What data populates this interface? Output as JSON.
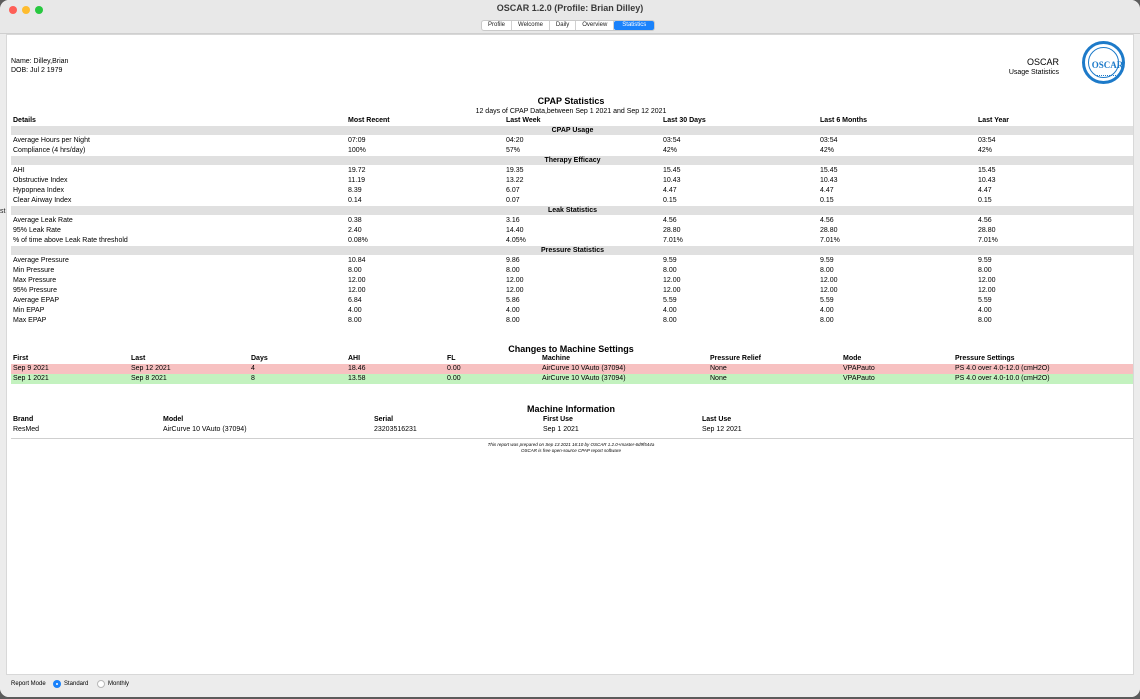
{
  "window": {
    "title": "OSCAR 1.2.0 (Profile: Brian Dilley)"
  },
  "tabs": [
    {
      "label": "Profile",
      "active": false
    },
    {
      "label": "Welcome",
      "active": false
    },
    {
      "label": "Daily",
      "active": false
    },
    {
      "label": "Overview",
      "active": false
    },
    {
      "label": "Statistics",
      "active": true
    }
  ],
  "header": {
    "name": "Name: Dilley,Brian",
    "dob": "DOB: Jul 2 1979",
    "app": "OSCAR",
    "subtitle": "Usage Statistics",
    "logo_text": "OSCAR"
  },
  "cpap": {
    "title": "CPAP Statistics",
    "subtitle": "12 days of CPAP Data,between Sep 1 2021 and Sep 12 2021",
    "columns": [
      "Details",
      "Most Recent",
      "Last Week",
      "Last 30 Days",
      "Last 6 Months",
      "Last Year"
    ],
    "sections": [
      {
        "title": "CPAP Usage",
        "rows": [
          [
            "Average Hours per Night",
            "07:09",
            "04:20",
            "03:54",
            "03:54",
            "03:54"
          ],
          [
            "Compliance (4 hrs/day)",
            "100%",
            "57%",
            "42%",
            "42%",
            "42%"
          ]
        ]
      },
      {
        "title": "Therapy Efficacy",
        "rows": [
          [
            "AHI",
            "19.72",
            "19.35",
            "15.45",
            "15.45",
            "15.45"
          ],
          [
            "Obstructive Index",
            "11.19",
            "13.22",
            "10.43",
            "10.43",
            "10.43"
          ],
          [
            "Hypopnea Index",
            "8.39",
            "6.07",
            "4.47",
            "4.47",
            "4.47"
          ],
          [
            "Clear Airway Index",
            "0.14",
            "0.07",
            "0.15",
            "0.15",
            "0.15"
          ]
        ]
      },
      {
        "title": "Leak Statistics",
        "rows": [
          [
            "Average Leak Rate",
            "0.38",
            "3.16",
            "4.56",
            "4.56",
            "4.56"
          ],
          [
            "95% Leak Rate",
            "2.40",
            "14.40",
            "28.80",
            "28.80",
            "28.80"
          ],
          [
            "% of time above Leak Rate threshold",
            "0.08%",
            "4.05%",
            "7.01%",
            "7.01%",
            "7.01%"
          ]
        ]
      },
      {
        "title": "Pressure Statistics",
        "rows": [
          [
            "Average Pressure",
            "10.84",
            "9.86",
            "9.59",
            "9.59",
            "9.59"
          ],
          [
            "Min Pressure",
            "8.00",
            "8.00",
            "8.00",
            "8.00",
            "8.00"
          ],
          [
            "Max Pressure",
            "12.00",
            "12.00",
            "12.00",
            "12.00",
            "12.00"
          ],
          [
            "95% Pressure",
            "12.00",
            "12.00",
            "12.00",
            "12.00",
            "12.00"
          ],
          [
            "Average EPAP",
            "6.84",
            "5.86",
            "5.59",
            "5.59",
            "5.59"
          ],
          [
            "Min EPAP",
            "4.00",
            "4.00",
            "4.00",
            "4.00",
            "4.00"
          ],
          [
            "Max EPAP",
            "8.00",
            "8.00",
            "8.00",
            "8.00",
            "8.00"
          ]
        ]
      }
    ]
  },
  "changes": {
    "title": "Changes to Machine Settings",
    "columns": [
      "First",
      "Last",
      "Days",
      "AHI",
      "FL",
      "Machine",
      "Pressure Relief",
      "Mode",
      "Pressure Settings"
    ],
    "rows": [
      {
        "color": "#f7c1c1",
        "cells": [
          "Sep 9 2021",
          "Sep 12 2021",
          "4",
          "18.46",
          "0.00",
          "AirCurve 10 VAuto (37094)",
          "None",
          "VPAPauto",
          "PS 4.0 over 4.0-12.0 (cmH2O)"
        ]
      },
      {
        "color": "#c3f2bf",
        "cells": [
          "Sep 1 2021",
          "Sep 8 2021",
          "8",
          "13.58",
          "0.00",
          "AirCurve 10 VAuto (37094)",
          "None",
          "VPAPauto",
          "PS 4.0 over 4.0-10.0 (cmH2O)"
        ]
      }
    ]
  },
  "machine": {
    "title": "Machine Information",
    "columns": [
      "Brand",
      "Model",
      "Serial",
      "First Use",
      "Last Use"
    ],
    "rows": [
      [
        "ResMed",
        "AirCurve 10 VAuto (37094)",
        "23203516231",
        "Sep 1 2021",
        "Sep 12 2021"
      ]
    ]
  },
  "footer": {
    "line1": "This report was prepared on Sep 13 2021 16:10 by OSCAR 1.2.0+master-6d9f544a",
    "line2": "OSCAR is free open-source CPAP report software"
  },
  "report_mode": {
    "label": "Report Mode",
    "options": [
      {
        "label": "Standard",
        "selected": true
      },
      {
        "label": "Monthly",
        "selected": false
      }
    ]
  },
  "edge_text": "st"
}
